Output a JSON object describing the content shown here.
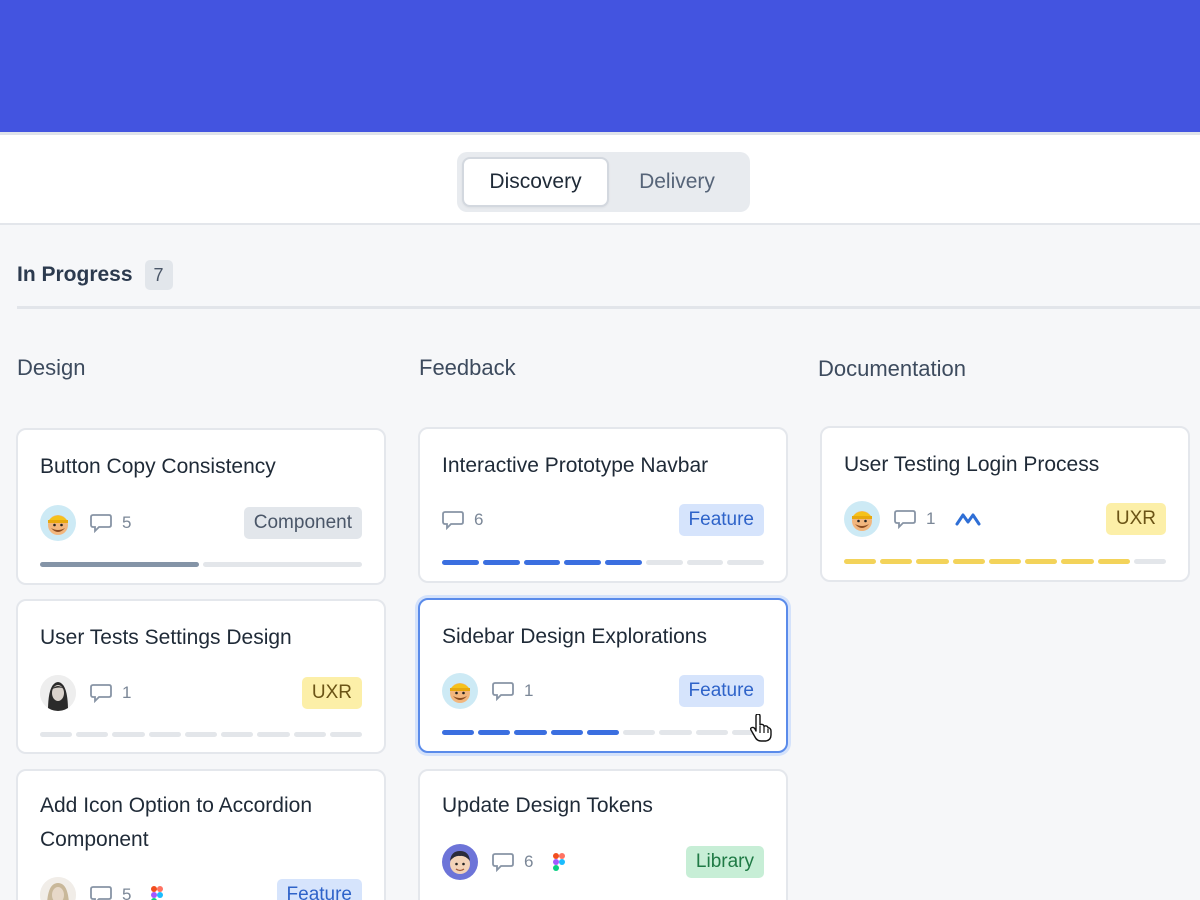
{
  "tabs": [
    {
      "label": "Discovery",
      "active": true
    },
    {
      "label": "Delivery",
      "active": false
    }
  ],
  "section": {
    "title": "In Progress",
    "count": "7"
  },
  "columns": [
    {
      "title": "Design",
      "cards": [
        {
          "title": "Button Copy Consistency",
          "comments": "5",
          "tag": "Component",
          "progress": 0.5,
          "color": "#8494a7"
        },
        {
          "title": "User Tests Settings Design",
          "comments": "1",
          "tag": "UXR",
          "progress": 0.0,
          "color": "#e3e6ea"
        },
        {
          "title": "Add Icon Option to Accordion Component",
          "comments": "5",
          "tag": "Feature",
          "tool": "figma-icon"
        }
      ]
    },
    {
      "title": "Feedback",
      "cards": [
        {
          "title": "Interactive Prototype Navbar",
          "comments": "6",
          "tag": "Feature",
          "progress": 0.625,
          "color": "#3b6fe0"
        },
        {
          "title": "Sidebar Design Explorations",
          "comments": "1",
          "tag": "Feature",
          "progress": 0.5556,
          "color": "#3b6fe0"
        },
        {
          "title": "Update Design Tokens",
          "comments": "6",
          "tag": "Library",
          "tool": "figma-icon"
        }
      ]
    },
    {
      "title": "Documentation",
      "cards": [
        {
          "title": "User Testing Login Process",
          "comments": "1",
          "tag": "UXR",
          "tool": "maze-icon",
          "progress": 0.9,
          "color": "#f3d35a"
        }
      ]
    }
  ],
  "colors": {
    "banner": "#4354e0",
    "feature_blue": "#3b6fe0",
    "uxr_yellow": "#f3d35a"
  }
}
